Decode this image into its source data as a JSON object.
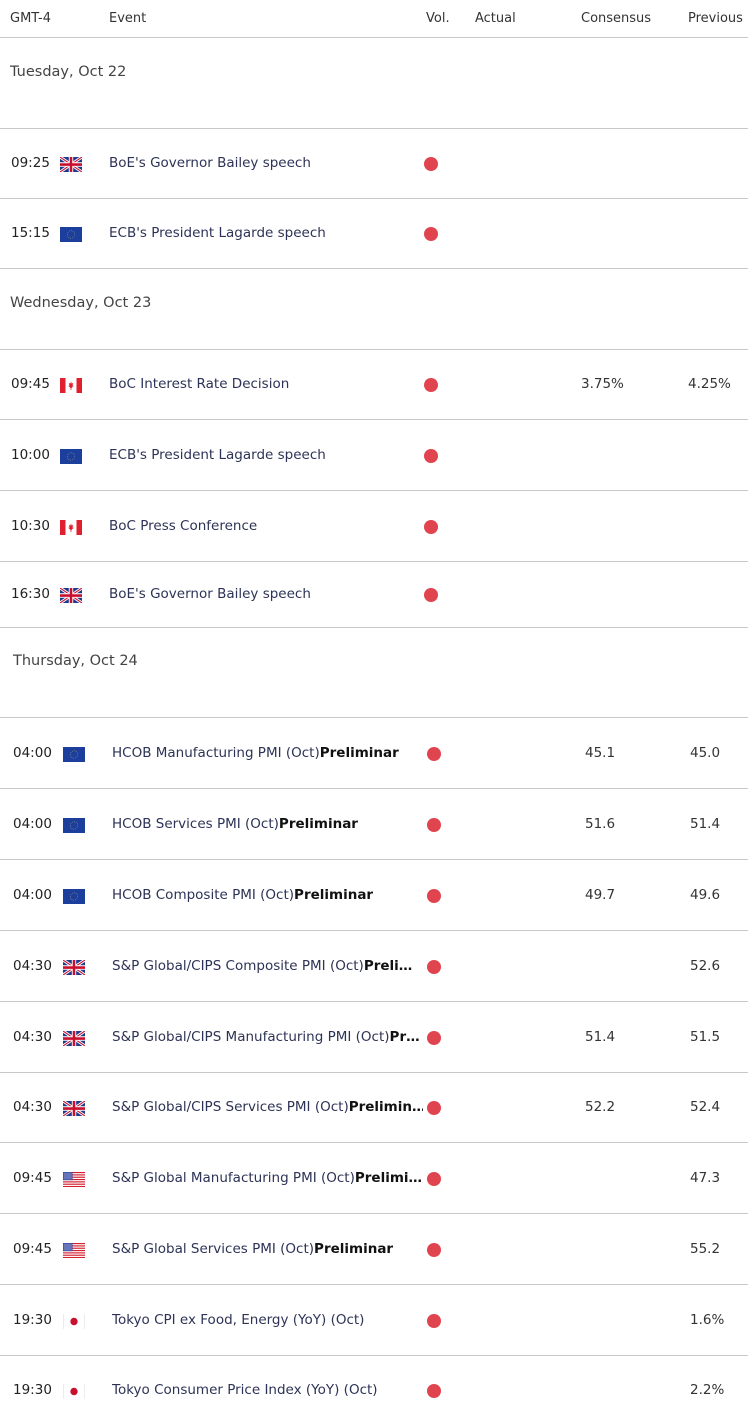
{
  "header": {
    "timezone": "GMT-4",
    "event": "Event",
    "vol": "Vol.",
    "actual": "Actual",
    "consensus": "Consensus",
    "previous": "Previous"
  },
  "colors": {
    "volatility_high": "#e0444e",
    "event_text": "#2d3356",
    "divider": "#c8c8c8"
  },
  "days": [
    {
      "label": "Tuesday, Oct 22",
      "events": [
        {
          "time": "09:25",
          "country": "uk-flag",
          "name": "BoE's Governor Bailey speech",
          "suffix": "",
          "vol": "high",
          "actual": "",
          "consensus": "",
          "previous": ""
        },
        {
          "time": "15:15",
          "country": "eu-flag",
          "name": "ECB's President Lagarde speech",
          "suffix": "",
          "vol": "high",
          "actual": "",
          "consensus": "",
          "previous": ""
        }
      ]
    },
    {
      "label": "Wednesday, Oct 23",
      "events": [
        {
          "time": "09:45",
          "country": "canada-flag",
          "name": "BoC Interest Rate Decision",
          "suffix": "",
          "vol": "high",
          "actual": "",
          "consensus": "3.75%",
          "previous": "4.25%"
        },
        {
          "time": "10:00",
          "country": "eu-flag",
          "name": "ECB's President Lagarde speech",
          "suffix": "",
          "vol": "high",
          "actual": "",
          "consensus": "",
          "previous": ""
        },
        {
          "time": "10:30",
          "country": "canada-flag",
          "name": "BoC Press Conference",
          "suffix": "",
          "vol": "high",
          "actual": "",
          "consensus": "",
          "previous": ""
        },
        {
          "time": "16:30",
          "country": "uk-flag",
          "name": "BoE's Governor Bailey speech",
          "suffix": "",
          "vol": "high",
          "actual": "",
          "consensus": "",
          "previous": ""
        }
      ]
    },
    {
      "label": "Thursday, Oct 24",
      "events": [
        {
          "time": "04:00",
          "country": "eu-flag",
          "name": "HCOB Manufacturing PMI (Oct)",
          "suffix": "Preliminar",
          "vol": "high",
          "actual": "",
          "consensus": "45.1",
          "previous": "45.0"
        },
        {
          "time": "04:00",
          "country": "eu-flag",
          "name": "HCOB Services PMI (Oct)",
          "suffix": "Preliminar",
          "vol": "high",
          "actual": "",
          "consensus": "51.6",
          "previous": "51.4"
        },
        {
          "time": "04:00",
          "country": "eu-flag",
          "name": "HCOB Composite PMI (Oct)",
          "suffix": "Preliminar",
          "vol": "high",
          "actual": "",
          "consensus": "49.7",
          "previous": "49.6"
        },
        {
          "time": "04:30",
          "country": "uk-flag",
          "name": "S&P Global/CIPS Composite PMI (Oct)",
          "suffix": "Preli…",
          "vol": "high",
          "actual": "",
          "consensus": "",
          "previous": "52.6"
        },
        {
          "time": "04:30",
          "country": "uk-flag",
          "name": "S&P Global/CIPS Manufacturing PMI (Oct)",
          "suffix": "Pr…",
          "vol": "high",
          "actual": "",
          "consensus": "51.4",
          "previous": "51.5"
        },
        {
          "time": "04:30",
          "country": "uk-flag",
          "name": "S&P Global/CIPS Services PMI (Oct)",
          "suffix": "Prelimin…",
          "vol": "high",
          "actual": "",
          "consensus": "52.2",
          "previous": "52.4"
        },
        {
          "time": "09:45",
          "country": "us-flag",
          "name": "S&P Global Manufacturing PMI (Oct)",
          "suffix": "Prelimi…",
          "vol": "high",
          "actual": "",
          "consensus": "",
          "previous": "47.3"
        },
        {
          "time": "09:45",
          "country": "us-flag",
          "name": "S&P Global Services PMI (Oct)",
          "suffix": "Preliminar",
          "vol": "high",
          "actual": "",
          "consensus": "",
          "previous": "55.2"
        },
        {
          "time": "19:30",
          "country": "japan-flag",
          "name": "Tokyo CPI ex Food, Energy (YoY) (Oct)",
          "suffix": "",
          "vol": "high",
          "actual": "",
          "consensus": "",
          "previous": "1.6%"
        },
        {
          "time": "19:30",
          "country": "japan-flag",
          "name": "Tokyo Consumer Price Index (YoY) (Oct)",
          "suffix": "",
          "vol": "high",
          "actual": "",
          "consensus": "",
          "previous": "2.2%"
        }
      ]
    }
  ]
}
